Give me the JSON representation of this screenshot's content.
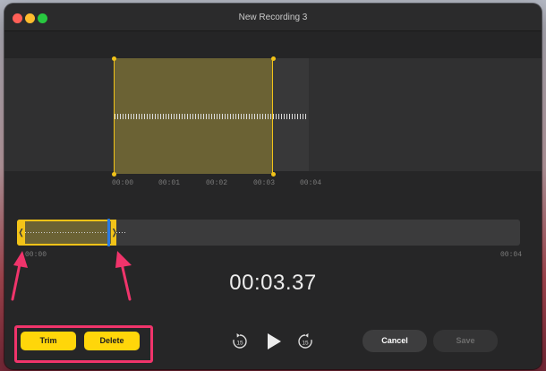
{
  "window": {
    "title": "New Recording 3"
  },
  "waveform": {
    "ticks": [
      "00:00",
      "00:01",
      "00:02",
      "00:03",
      "00:04"
    ]
  },
  "overview": {
    "start_label": "00:00",
    "end_label": "00:04",
    "left_handle_glyph": "❬",
    "right_handle_glyph": "❭"
  },
  "playback": {
    "time": "00:03.37",
    "skip_back_label": "15",
    "skip_forward_label": "15"
  },
  "buttons": {
    "trim": "Trim",
    "delete": "Delete",
    "cancel": "Cancel",
    "save": "Save"
  },
  "colors": {
    "accent_yellow": "#ffd60a",
    "selection_border": "#f2c318",
    "playhead_blue": "#2c7ce3",
    "annotation_pink": "#f0346b"
  }
}
